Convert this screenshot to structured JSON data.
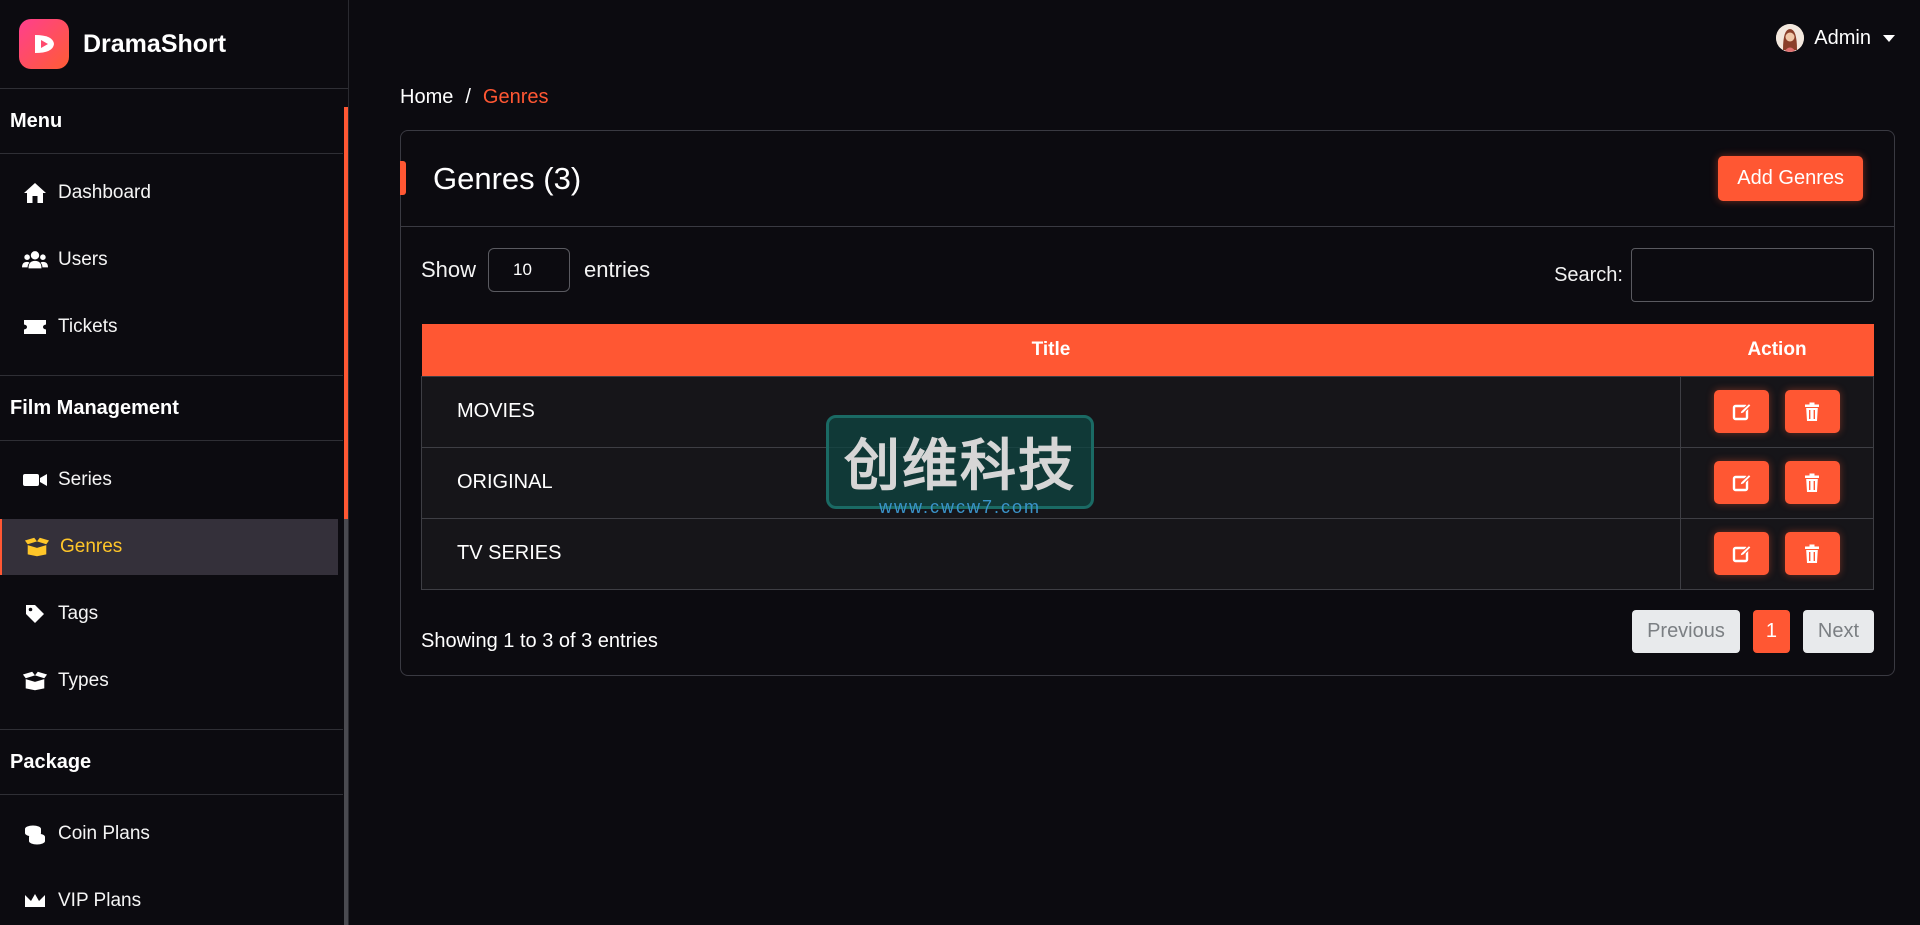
{
  "brand": {
    "name": "DramaShort",
    "gradient": [
      "#ff3f8e",
      "#ff5c34"
    ]
  },
  "colors": {
    "accent": "#ff5733",
    "active_text": "#ffc629",
    "background": "#0c0b10"
  },
  "sidebar": {
    "sections": [
      {
        "title": "Menu",
        "items": [
          {
            "label": "Dashboard",
            "icon": "home-icon"
          },
          {
            "label": "Users",
            "icon": "users-icon"
          },
          {
            "label": "Tickets",
            "icon": "ticket-icon"
          }
        ]
      },
      {
        "title": "Film Management",
        "items": [
          {
            "label": "Series",
            "icon": "video-icon"
          },
          {
            "label": "Genres",
            "icon": "box-open-icon",
            "active": true
          },
          {
            "label": "Tags",
            "icon": "tag-icon"
          },
          {
            "label": "Types",
            "icon": "boxes-icon"
          }
        ]
      },
      {
        "title": "Package",
        "items": [
          {
            "label": "Coin Plans",
            "icon": "coins-icon"
          },
          {
            "label": "VIP Plans",
            "icon": "crown-icon"
          }
        ]
      }
    ]
  },
  "header": {
    "user_name": "Admin"
  },
  "breadcrumb": {
    "home": "Home",
    "separator": "/",
    "current": "Genres"
  },
  "card": {
    "title": "Genres (3)",
    "add_button": "Add Genres"
  },
  "table_controls": {
    "show_label": "Show",
    "entries_label": "entries",
    "page_length": "10",
    "search_label": "Search:",
    "search_value": ""
  },
  "table": {
    "columns": [
      "Title",
      "Action"
    ],
    "rows": [
      {
        "title": "MOVIES"
      },
      {
        "title": "ORIGINAL"
      },
      {
        "title": "TV SERIES"
      }
    ]
  },
  "footer": {
    "info": "Showing 1 to 3 of 3 entries",
    "previous": "Previous",
    "current_page": "1",
    "next": "Next"
  },
  "watermark": {
    "text": "创维科技",
    "url": "www.cwcw7.com"
  }
}
